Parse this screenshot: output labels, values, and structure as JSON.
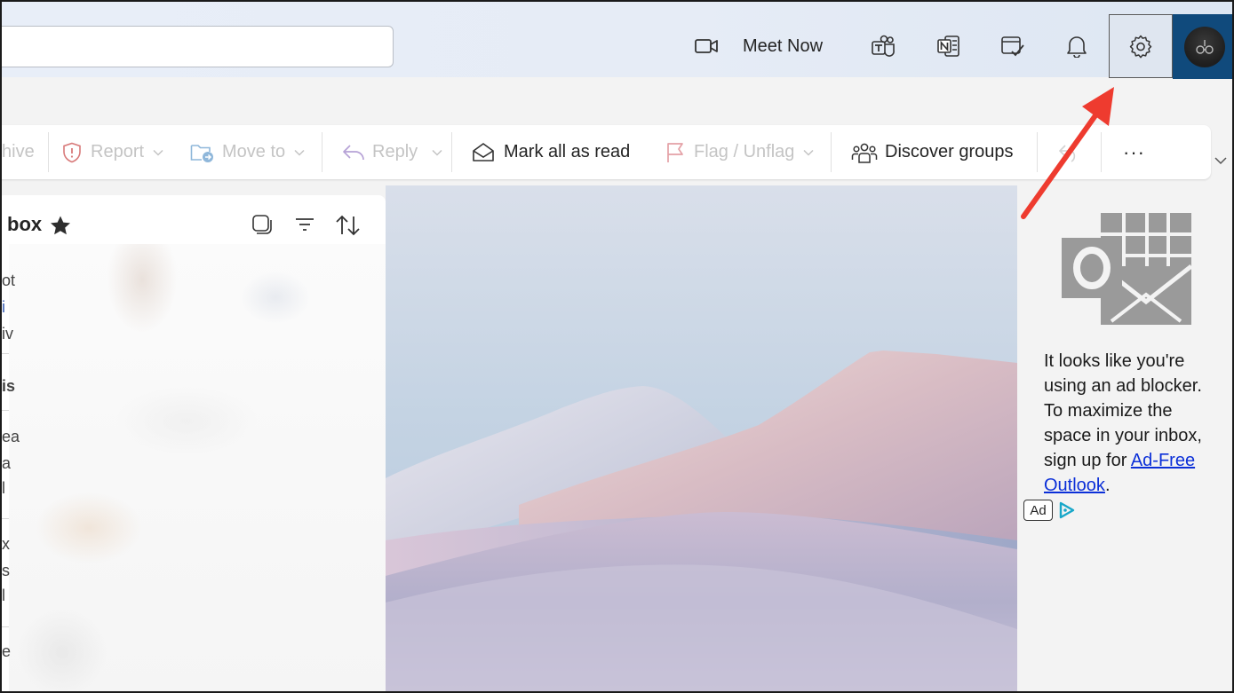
{
  "header": {
    "search_value": "",
    "meet_now_label": "Meet Now",
    "icons": [
      "video-camera-icon",
      "teams-icon",
      "onenote-icon",
      "todo-icon",
      "bell-icon",
      "gear-icon"
    ]
  },
  "toolbar": {
    "archive_label": "hive",
    "report_label": "Report",
    "move_to_label": "Move to",
    "reply_label": "Reply",
    "mark_all_read_label": "Mark all as read",
    "flag_label": "Flag / Unflag",
    "discover_groups_label": "Discover groups",
    "more_label": "···"
  },
  "mail_list": {
    "folder_title": "box",
    "edge_fragments": [
      "ot",
      "i",
      "iv",
      "is",
      "ea",
      "a",
      "l",
      "x",
      "s",
      "l",
      "e"
    ]
  },
  "ad": {
    "text_before_link": "It looks like you're using an ad blocker. To maximize the space in your inbox, sign up for ",
    "link_text": "Ad-Free Outlook",
    "text_after_link": ".",
    "badge": "Ad"
  },
  "colors": {
    "accent_red": "#ee3b2f",
    "avatar_bg": "#104a7c",
    "link_blue": "#0b2fd8",
    "disabled_text": "#c4c4c4"
  }
}
